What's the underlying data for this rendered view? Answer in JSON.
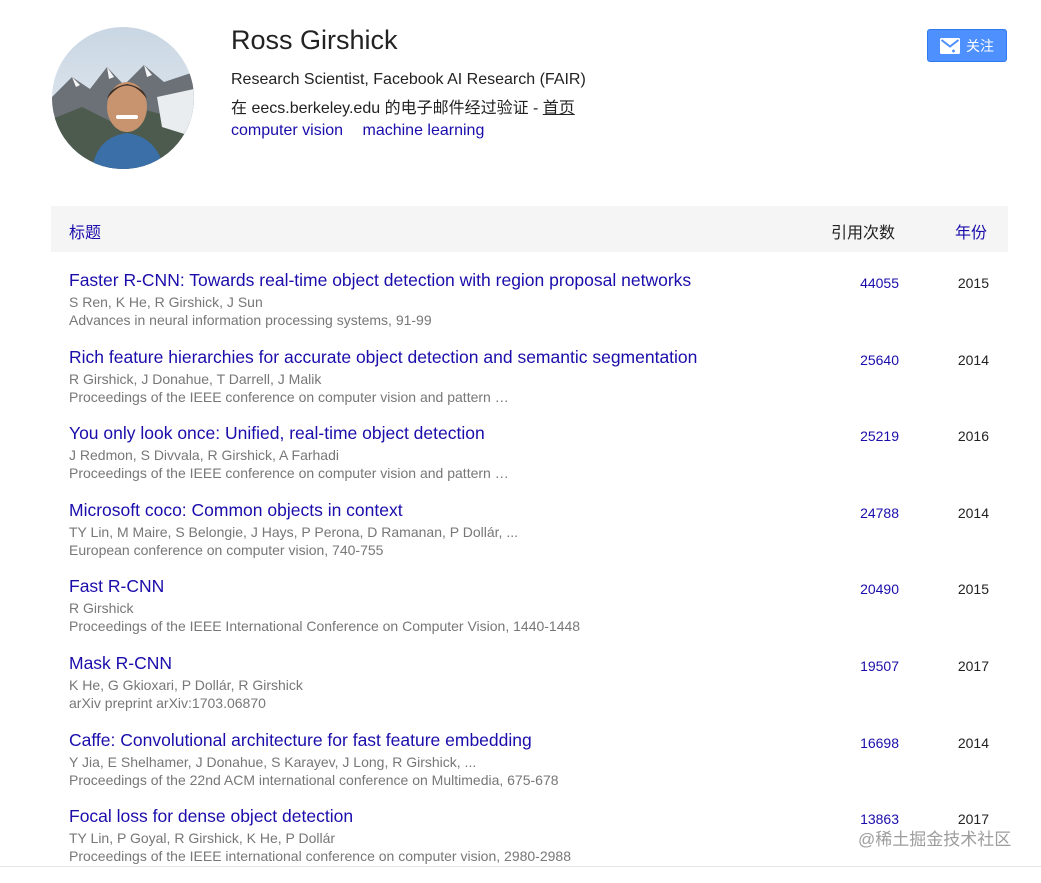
{
  "profile": {
    "name": "Ross Girshick",
    "affiliation": "Research Scientist, Facebook AI Research (FAIR)",
    "verified_prefix": "在 eecs.berkeley.edu 的电子邮件经过验证 - ",
    "homepage_label": "首页",
    "interests": [
      "computer vision",
      "machine learning"
    ],
    "follow_label": "关注"
  },
  "table": {
    "header": {
      "title": "标题",
      "cited_by": "引用次数",
      "year": "年份"
    },
    "rows": [
      {
        "title": "Faster R-CNN: Towards real-time object detection with region proposal networks",
        "authors": "S Ren, K He, R Girshick, J Sun",
        "venue": "Advances in neural information processing systems, 91-99",
        "cites": "44055",
        "year": "2015"
      },
      {
        "title": "Rich feature hierarchies for accurate object detection and semantic segmentation",
        "authors": "R Girshick, J Donahue, T Darrell, J Malik",
        "venue": "Proceedings of the IEEE conference on computer vision and pattern …",
        "cites": "25640",
        "year": "2014"
      },
      {
        "title": "You only look once: Unified, real-time object detection",
        "authors": "J Redmon, S Divvala, R Girshick, A Farhadi",
        "venue": "Proceedings of the IEEE conference on computer vision and pattern …",
        "cites": "25219",
        "year": "2016"
      },
      {
        "title": "Microsoft coco: Common objects in context",
        "authors": "TY Lin, M Maire, S Belongie, J Hays, P Perona, D Ramanan, P Dollár, ...",
        "venue": "European conference on computer vision, 740-755",
        "cites": "24788",
        "year": "2014"
      },
      {
        "title": "Fast R-CNN",
        "authors": "R Girshick",
        "venue": "Proceedings of the IEEE International Conference on Computer Vision, 1440-1448",
        "cites": "20490",
        "year": "2015"
      },
      {
        "title": "Mask R-CNN",
        "authors": "K He, G Gkioxari, P Dollár, R Girshick",
        "venue": "arXiv preprint arXiv:1703.06870",
        "cites": "19507",
        "year": "2017"
      },
      {
        "title": "Caffe: Convolutional architecture for fast feature embedding",
        "authors": "Y Jia, E Shelhamer, J Donahue, S Karayev, J Long, R Girshick, ...",
        "venue": "Proceedings of the 22nd ACM international conference on Multimedia, 675-678",
        "cites": "16698",
        "year": "2014"
      },
      {
        "title": "Focal loss for dense object detection",
        "authors": "TY Lin, P Goyal, R Girshick, K He, P Dollár",
        "venue": "Proceedings of the IEEE international conference on computer vision, 2980-2988",
        "cites": "13863",
        "year": "2017"
      }
    ]
  },
  "watermark": "@稀土掘金技术社区",
  "colors": {
    "link": "#1a0dab",
    "muted": "#777777",
    "button": "#4d90fe",
    "header_bg": "#f5f5f5"
  }
}
